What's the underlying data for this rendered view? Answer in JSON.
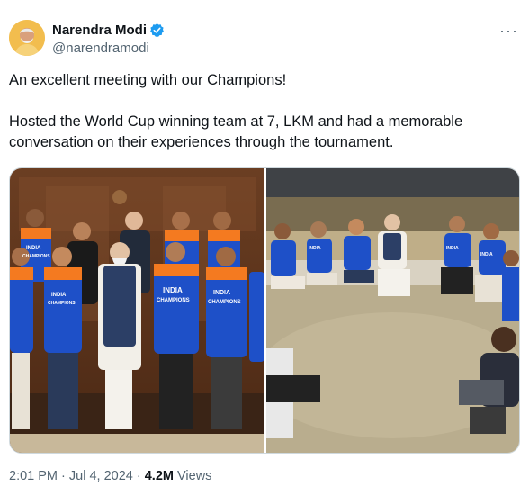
{
  "author": {
    "name": "Narendra Modi",
    "handle": "@narendramodi"
  },
  "tweet": {
    "line1": "An excellent meeting with our Champions!",
    "line2": "Hosted the World Cup winning team at 7, LKM and had a memorable conversation on their experiences through the tournament."
  },
  "jersey_text": {
    "india": "INDIA",
    "champions": "CHAMPIONS"
  },
  "meta": {
    "time": "2:01 PM",
    "sep1": " · ",
    "date": "Jul 4, 2024",
    "sep2": " · ",
    "views": "4.2M",
    "views_label": " Views"
  },
  "colors": {
    "jersey_blue": "#1e50c8",
    "jersey_orange": "#f47a20",
    "verified_blue": "#1d9bf0",
    "text_secondary": "#536471"
  }
}
